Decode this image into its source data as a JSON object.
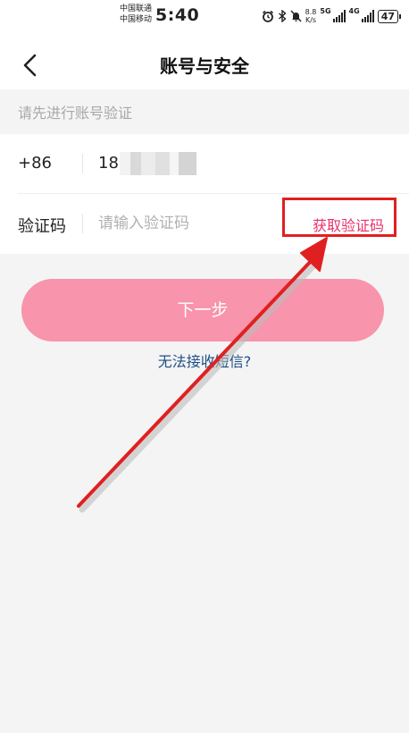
{
  "status_bar": {
    "carrier_1": "中国联通",
    "carrier_2": "中国移动",
    "time": "5:40",
    "net_speed_value": "8.8",
    "net_speed_unit": "K/s",
    "net_type_1": "5G",
    "net_type_2": "4G",
    "battery": "47"
  },
  "header": {
    "title": "账号与安全"
  },
  "verify_hint": "请先进行账号验证",
  "phone_row": {
    "country_code": "+86",
    "phone_number_visible": "18"
  },
  "code_row": {
    "label": "验证码",
    "placeholder": "请输入验证码",
    "get_code": "获取验证码"
  },
  "next_button": "下一步",
  "no_sms_link": "无法接收短信?",
  "colors": {
    "accent": "#e8326a",
    "button_bg": "#f894ab",
    "link": "#1d4f86",
    "annotation_red": "#e02020"
  }
}
